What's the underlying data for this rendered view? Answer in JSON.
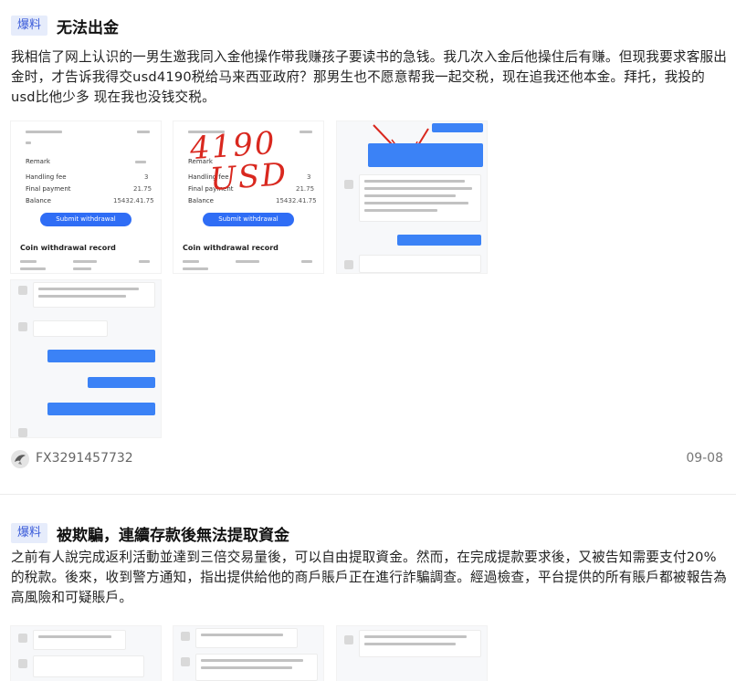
{
  "posts": [
    {
      "tag": "爆料",
      "title": "无法出金",
      "body": "我相信了网上认识的一男生邀我同入金他操作带我赚孩子要读书的急钱。我几次入金后他操住后有赚。但现我要求客服出金时，才告诉我得交usd4190税给马来西亚政府？那男生也不愿意帮我一起交税，现在追我还他本金。拜托，我投的usd比他少多 现在我也没钱交税。",
      "images": {
        "screenshot1": {
          "labels": [
            "Remark",
            "Handling fee",
            "Final payment",
            "Balance"
          ],
          "values": [
            "3",
            "21.75",
            "15432.41.75"
          ],
          "button": "Submit withdrawal",
          "subheading": "Coin withdrawal record"
        },
        "screenshot2": {
          "annotation_line1": "4190",
          "annotation_line2": "USD",
          "labels": [
            "Remark",
            "Handling fee",
            "Final payment",
            "Balance"
          ],
          "values": [
            "3",
            "21.75",
            "15432.41.75"
          ],
          "button": "Submit withdrawal",
          "subheading": "Coin withdrawal record"
        }
      },
      "author": "FX3291457732",
      "date": "09-08"
    },
    {
      "tag": "爆料",
      "title": "被欺騙，連續存款後無法提取資金",
      "body": "之前有人說完成返利活動並達到三倍交易量後，可以自由提取資金。然而，在完成提款要求後，又被告知需要支付20%的稅款。後來，收到警方通知，指出提供給他的商戶賬戶正在進行詐騙調查。經過檢查，平台提供的所有賬戶都被報告為高風險和可疑賬戶。"
    }
  ],
  "colors": {
    "tag_bg": "#e6ecfb",
    "tag_text": "#3a5bd9",
    "primary_button": "#2f6df5",
    "annotation_red": "#d9281f"
  }
}
